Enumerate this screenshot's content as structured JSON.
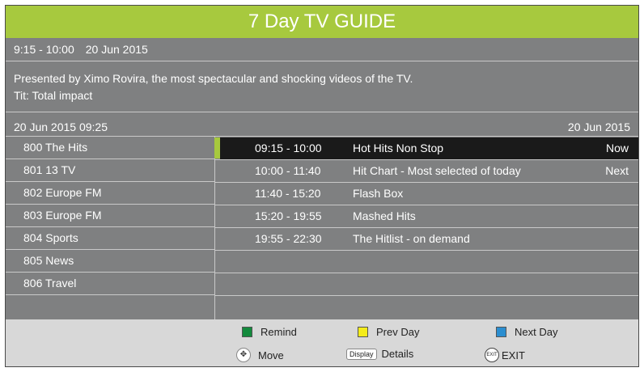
{
  "header": {
    "title": "7 Day TV GUIDE"
  },
  "info": {
    "time_range": "9:15 - 10:00",
    "date": "20 Jun 2015",
    "description": "Presented by Ximo Rovira, the most spectacular and shocking videos of the TV.",
    "subtitle": "Tit: Total impact"
  },
  "date_bar": {
    "current": "20 Jun 2015 09:25",
    "selected_day": "20 Jun 2015"
  },
  "channels": [
    {
      "label": "800 The Hits"
    },
    {
      "label": "801 13 TV"
    },
    {
      "label": "802 Europe FM"
    },
    {
      "label": "803 Europe FM"
    },
    {
      "label": "804 Sports"
    },
    {
      "label": "805 News"
    },
    {
      "label": "806 Travel"
    }
  ],
  "programs": [
    {
      "time": "09:15 - 10:00",
      "name": "Hot Hits Non Stop",
      "status": "Now"
    },
    {
      "time": "10:00 - 11:40",
      "name": "Hit Chart - Most selected of today",
      "status": "Next"
    },
    {
      "time": "11:40 - 15:20",
      "name": "Flash Box",
      "status": ""
    },
    {
      "time": "15:20 - 19:55",
      "name": "Mashed Hits",
      "status": ""
    },
    {
      "time": "19:55 - 22:30",
      "name": "The Hitlist - on demand",
      "status": ""
    }
  ],
  "footer": {
    "remind": "Remind",
    "prev_day": "Prev Day",
    "next_day": "Next Day",
    "move": "Move",
    "display_icon_label": "Display",
    "details": "Details",
    "exit_icon_label": "EXIT",
    "exit": "EXIT"
  },
  "colors": {
    "accent": "#a7c93e",
    "background": "#7f8081",
    "remind_key": "#138a3c",
    "prev_day_key": "#f4ec1a",
    "next_day_key": "#2b8ed0"
  }
}
